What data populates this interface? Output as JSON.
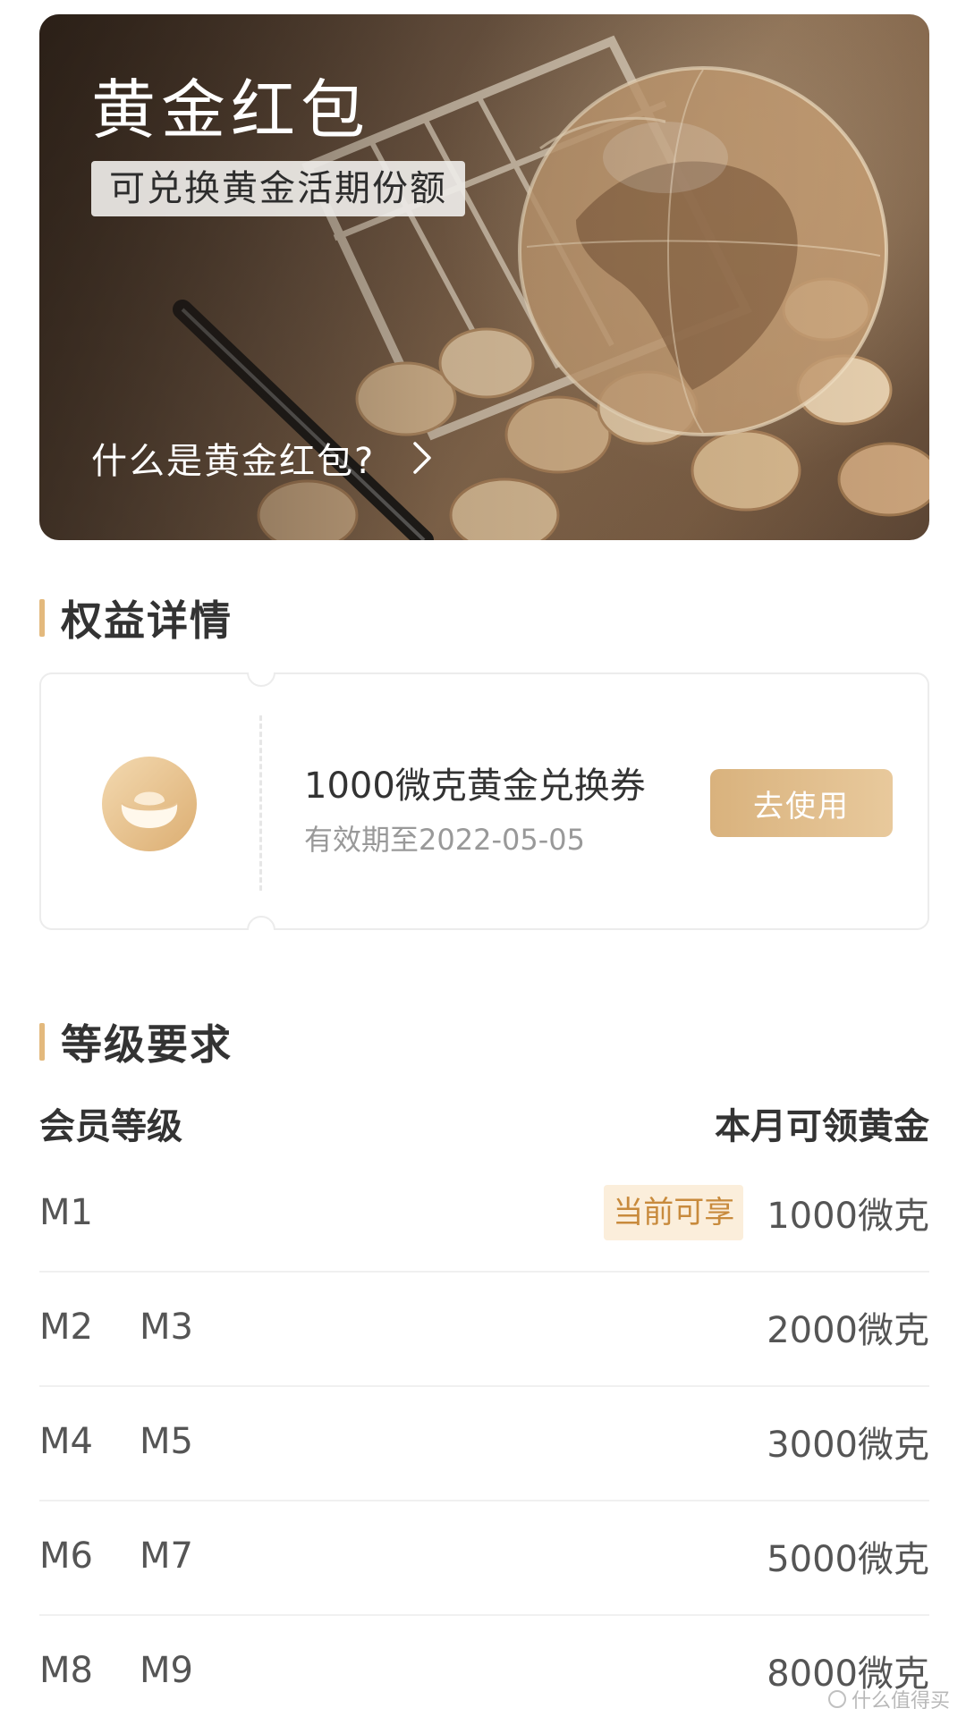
{
  "banner": {
    "title": "黄金红包",
    "tag": "可兑换黄金活期份额",
    "link_text": "什么是黄金红包?",
    "icons": [
      "chevron-right-icon"
    ]
  },
  "benefits": {
    "section_title": "权益详情",
    "coupon": {
      "icon": "gold-ingot-icon",
      "title": "1000微克黄金兑换券",
      "expiry": "有效期至2022-05-05",
      "button_label": "去使用"
    }
  },
  "levels": {
    "section_title": "等级要求",
    "header_left": "会员等级",
    "header_right": "本月可领黄金",
    "current_badge": "当前可享",
    "rows": [
      {
        "levels": [
          "M1"
        ],
        "amount": "1000微克",
        "current": true
      },
      {
        "levels": [
          "M2",
          "M3"
        ],
        "amount": "2000微克",
        "current": false
      },
      {
        "levels": [
          "M4",
          "M5"
        ],
        "amount": "3000微克",
        "current": false
      },
      {
        "levels": [
          "M6",
          "M7"
        ],
        "amount": "5000微克",
        "current": false
      },
      {
        "levels": [
          "M8",
          "M9"
        ],
        "amount": "8000微克",
        "current": false
      }
    ]
  },
  "watermark": "什么值得买",
  "colors": {
    "accent_gold": "#e3b97d",
    "button_gold_start": "#d9b27d",
    "button_gold_end": "#e8c99c",
    "badge_bg": "#fbeedb",
    "badge_text": "#c88a3c"
  }
}
